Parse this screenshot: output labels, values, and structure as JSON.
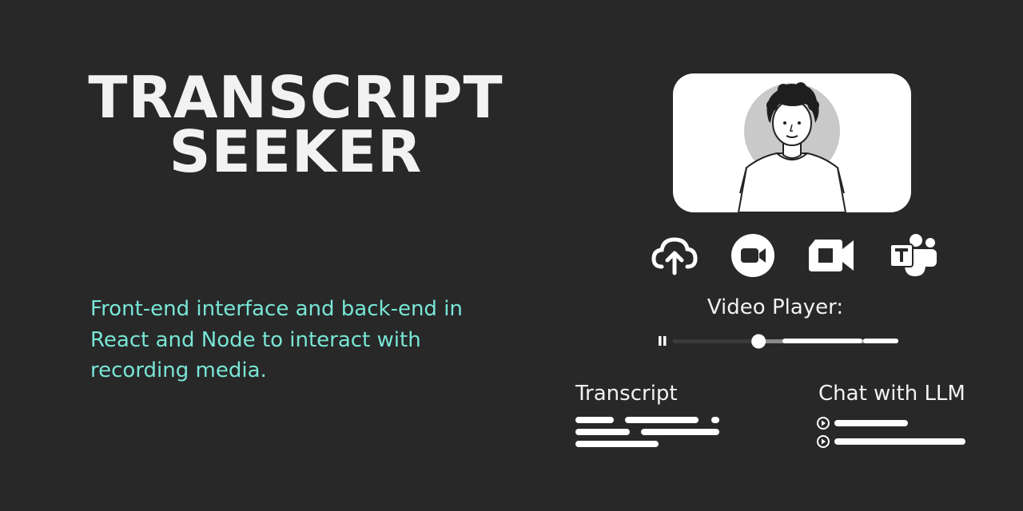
{
  "title": {
    "line1": "TRANSCRIPT",
    "line2": "SEEKER"
  },
  "subtitle": "Front-end interface and back-end in React and Node to interact with recording media.",
  "video_player": {
    "label": "Video Player:",
    "progress": 0.38
  },
  "icons": [
    "cloud-upload-icon",
    "zoom-icon",
    "google-meet-icon",
    "microsoft-teams-icon"
  ],
  "sections": {
    "transcript_label": "Transcript",
    "chat_label": "Chat with LLM"
  },
  "colors": {
    "background": "#282828",
    "accent": "#79e6d6",
    "text": "#f2f2f2"
  }
}
